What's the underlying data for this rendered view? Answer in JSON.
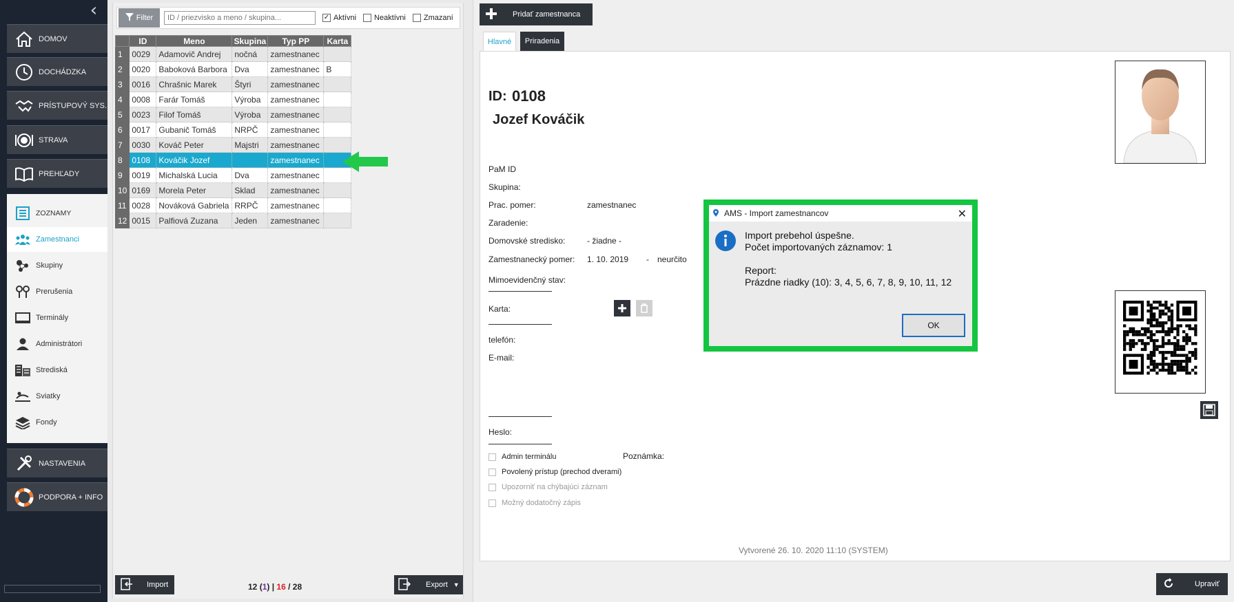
{
  "nav": {
    "main": [
      {
        "label": "DOMOV",
        "icon": "home-icon"
      },
      {
        "label": "DOCHÁDZKA",
        "icon": "clock-icon"
      },
      {
        "label": "PRÍSTUPOVÝ SYS.",
        "icon": "handshake-icon"
      },
      {
        "label": "STRAVA",
        "icon": "plate-icon"
      },
      {
        "label": "PREHĽADY",
        "icon": "book-icon"
      }
    ],
    "sub": [
      {
        "label": "ZOZNAMY",
        "icon": "list-icon"
      },
      {
        "label": "Zamestnanci",
        "icon": "people-icon"
      },
      {
        "label": "Skupiny",
        "icon": "group-icon"
      },
      {
        "label": "Prerušenia",
        "icon": "pins-icon"
      },
      {
        "label": "Terminály",
        "icon": "terminal-icon"
      },
      {
        "label": "Administrátori",
        "icon": "admin-icon"
      },
      {
        "label": "Strediská",
        "icon": "building-icon"
      },
      {
        "label": "Sviatky",
        "icon": "holiday-icon"
      },
      {
        "label": "Fondy",
        "icon": "layers-icon"
      }
    ],
    "bottom": [
      {
        "label": "NASTAVENIA",
        "icon": "tools-icon"
      },
      {
        "label": "PODPORA + INFO",
        "icon": "lifebuoy-icon"
      }
    ]
  },
  "filter": {
    "button_label": "Filter",
    "placeholder": "ID / priezvisko a meno / skupina...",
    "active_label": "Aktívni",
    "active_checked": true,
    "inactive_label": "Neaktívni",
    "inactive_checked": false,
    "deleted_label": "Zmazaní",
    "deleted_checked": false
  },
  "table": {
    "columns": [
      "ID",
      "Meno",
      "Skupina",
      "Typ PP",
      "Karta"
    ],
    "rows": [
      {
        "n": "1",
        "id": "0029",
        "name": "Adamovič Andrej",
        "group": "nočná",
        "type": "zamestnanec",
        "card": ""
      },
      {
        "n": "2",
        "id": "0020",
        "name": "Baboková Barbora",
        "group": "Dva",
        "type": "zamestnanec",
        "card": "B"
      },
      {
        "n": "3",
        "id": "0016",
        "name": "Chrašnic Marek",
        "group": "Štyri",
        "type": "zamestnanec",
        "card": ""
      },
      {
        "n": "4",
        "id": "0008",
        "name": "Farár Tomáš",
        "group": "Výroba",
        "type": "zamestnanec",
        "card": ""
      },
      {
        "n": "5",
        "id": "0023",
        "name": "Filof Tomáš",
        "group": "Výroba",
        "type": "zamestnanec",
        "card": ""
      },
      {
        "n": "6",
        "id": "0017",
        "name": "Gubanič Tomáš",
        "group": "NRPČ",
        "type": "zamestnanec",
        "card": ""
      },
      {
        "n": "7",
        "id": "0030",
        "name": "Kováč Peter",
        "group": "Majstri",
        "type": "zamestnanec",
        "card": ""
      },
      {
        "n": "8",
        "id": "0108",
        "name": "Kováčik Jozef",
        "group": "",
        "type": "zamestnanec",
        "card": ""
      },
      {
        "n": "9",
        "id": "0019",
        "name": "Michalská Lucia",
        "group": "Dva",
        "type": "zamestnanec",
        "card": ""
      },
      {
        "n": "10",
        "id": "0169",
        "name": "Morela Peter",
        "group": "Sklad",
        "type": "zamestnanec",
        "card": ""
      },
      {
        "n": "11",
        "id": "0028",
        "name": "Nováková Gabriela",
        "group": "RRPČ",
        "type": "zamestnanec",
        "card": ""
      },
      {
        "n": "12",
        "id": "0015",
        "name": "Palfiová Zuzana",
        "group": "Jeden",
        "type": "zamestnanec",
        "card": ""
      }
    ],
    "selected_row": 8
  },
  "list_footer": {
    "import_label": "Import",
    "count_a": "12",
    "count_b": "1",
    "count_c": "16",
    "count_total": "28",
    "export_label": "Export"
  },
  "detail": {
    "add_label": "Pridať zamestnanca",
    "tabs": [
      "Hlavné",
      "Priradenia"
    ],
    "id_label": "ID:",
    "id_value": "0108",
    "full_name": "Jozef Kováčik",
    "fields": {
      "pam_id": "PaM ID",
      "group": "Skupina:",
      "work_rel": "Prac. pomer:",
      "work_rel_value": "zamestnanec",
      "assignment": "Zaradenie:",
      "home_center": "Domovské stredisko:",
      "home_center_value": "- žiadne -",
      "employment": "Zamestnanecký pomer:",
      "employment_from": "1. 10. 2019",
      "employment_sep": "-",
      "employment_to": "neurčito",
      "extra_status": "Mimoevidenčný stav:",
      "card": "Karta:",
      "phone": "telefón:",
      "email": "E-mail:",
      "password": "Heslo:",
      "note": "Poznámka:"
    },
    "checks": [
      {
        "label": "Admin terminálu",
        "disabled": false
      },
      {
        "label": "Povolený prístup (prechod dverami)",
        "disabled": false
      },
      {
        "label": "Upozorniť na chýbajúci záznam",
        "disabled": true
      },
      {
        "label": "Možný dodatočný zápis",
        "disabled": true
      }
    ],
    "created": "Vytvorené 26. 10. 2020 11:10 (SYSTEM)",
    "edit_label": "Upraviť"
  },
  "dialog": {
    "title": "AMS - Import zamestnancov",
    "line1": "Import prebehol úspešne.",
    "line2": "Počet importovaných záznamov: 1",
    "line3": "Report:",
    "line4": "Prázdne riadky (10): 3, 4, 5, 6, 7, 8, 9, 10, 11, 12",
    "ok_label": "OK"
  },
  "colors": {
    "accent": "#1ba8ce",
    "highlight_green": "#13c540",
    "dark_button": "#2f343b"
  }
}
